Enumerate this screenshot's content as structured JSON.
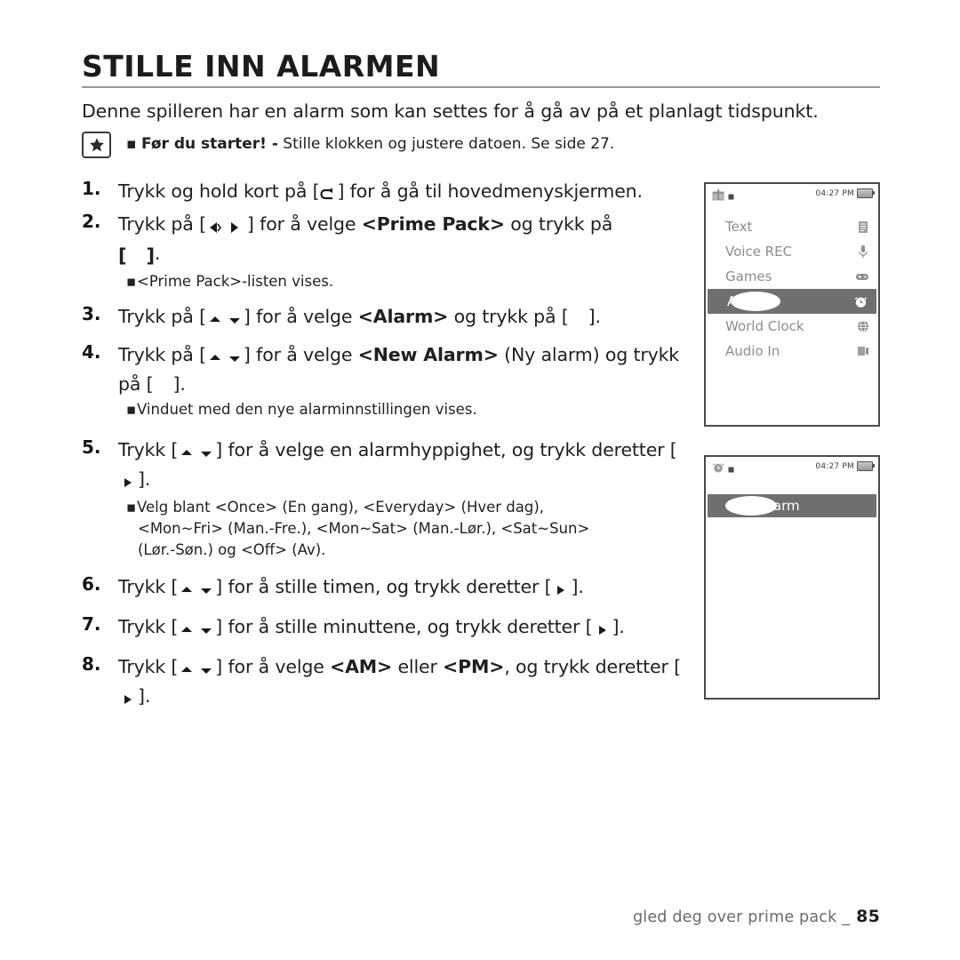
{
  "document": {
    "title": "STILLE INN ALARMEN",
    "intro": "Denne spilleren har en alarm som kan settes for å gå av på et planlagt tidspunkt.",
    "note": {
      "icon": "star-icon",
      "bullet": "▪",
      "bold_lead": "Før du starter! -",
      "rest": " Stille klokken og justere datoen. Se side 27."
    },
    "steps": [
      {
        "num": "1.",
        "text_before": "Trykk og hold kort på [",
        "key": "back-arrow-icon",
        "text_after": "] for å gå til hovedmenyskjermen."
      },
      {
        "num": "2.",
        "text_before": "Trykk på [",
        "key": "left-right-icon",
        "text_mid": "] for å velge ",
        "bold": "<Prime Pack>",
        "text_after": " og trykk på",
        "second_line_key": "blank-key",
        "second_line_after": "."
      },
      {
        "num": "3.",
        "text_before": "Trykk på [",
        "key": "up-down-icon",
        "text_mid": "] for å velge ",
        "bold": "<Alarm>",
        "text_after": " og trykk på [",
        "text_end": "]."
      },
      {
        "num": "4.",
        "text_before": "Trykk på [",
        "key": "up-down-icon",
        "text_mid": "] for å velge ",
        "bold": "<New Alarm>",
        "text_after": " (Ny alarm) og trykk på [",
        "text_end": "]."
      },
      {
        "num": "5.",
        "text_before": "Trykk [",
        "key": "up-down-icon",
        "text_mid": "] for å velge en alarmhyppighet, og trykk deretter [",
        "key2": "right-icon",
        "text_end": "]."
      },
      {
        "num": "6.",
        "text_before": "Trykk [",
        "key": "up-down-icon",
        "text_mid": "] for å stille timen, og trykk deretter [",
        "key2": "right-icon",
        "text_end": "]."
      },
      {
        "num": "7.",
        "text_before": "Trykk [",
        "key": "up-down-icon",
        "text_mid": "] for å stille minuttene, og trykk deretter [",
        "key2": "right-icon",
        "text_end": "]."
      },
      {
        "num": "8.",
        "text_before": "Trykk [",
        "key": "up-down-icon",
        "text_mid": "] for å velge ",
        "bold": "<AM>",
        "text_mid2": " eller ",
        "bold2": "<PM>",
        "text_after": ", og trykk deretter [",
        "key2": "right-icon",
        "text_end": "]."
      }
    ],
    "substeps": {
      "after_step2": "<Prime Pack>-listen vises.",
      "after_step4": "Vinduet med den nye alarminnstillingen vises.",
      "after_step5_line1": "Velg blant <Once> (En gang), <Everyday> (Hver dag),",
      "after_step5_line2": "<Mon~Fri> (Man.-Fre.), <Mon~Sat> (Man.-Lør.), <Sat~Sun>",
      "after_step5_line3": "(Lør.-Søn.) og <Off> (Av)."
    },
    "bullet_char": "▪"
  },
  "device_screen_1": {
    "status_time": "04:27 PM",
    "menu_items": [
      {
        "label": "Text",
        "icon": "document-icon",
        "selected": false
      },
      {
        "label": "Voice REC",
        "icon": "microphone-icon",
        "selected": false
      },
      {
        "label": "Games",
        "icon": "gamepad-icon",
        "selected": false
      },
      {
        "label": "Alarm",
        "icon": "alarm-clock-icon",
        "selected": true
      },
      {
        "label": "World Clock",
        "icon": "globe-icon",
        "selected": false
      },
      {
        "label": "Audio In",
        "icon": "audio-in-icon",
        "selected": false
      }
    ]
  },
  "device_screen_2": {
    "status_time": "04:27 PM",
    "header_icon": "alarm-clock-icon",
    "title": "New Alarm"
  },
  "footer": {
    "text": "gled deg over prime pack _",
    "page": "85"
  },
  "colors": {
    "selection_gray": "#6f6f6f",
    "menu_text_gray": "#8d8d8d",
    "rule_gray": "#9a9a9a",
    "footer_gray": "#6a6a6a"
  }
}
